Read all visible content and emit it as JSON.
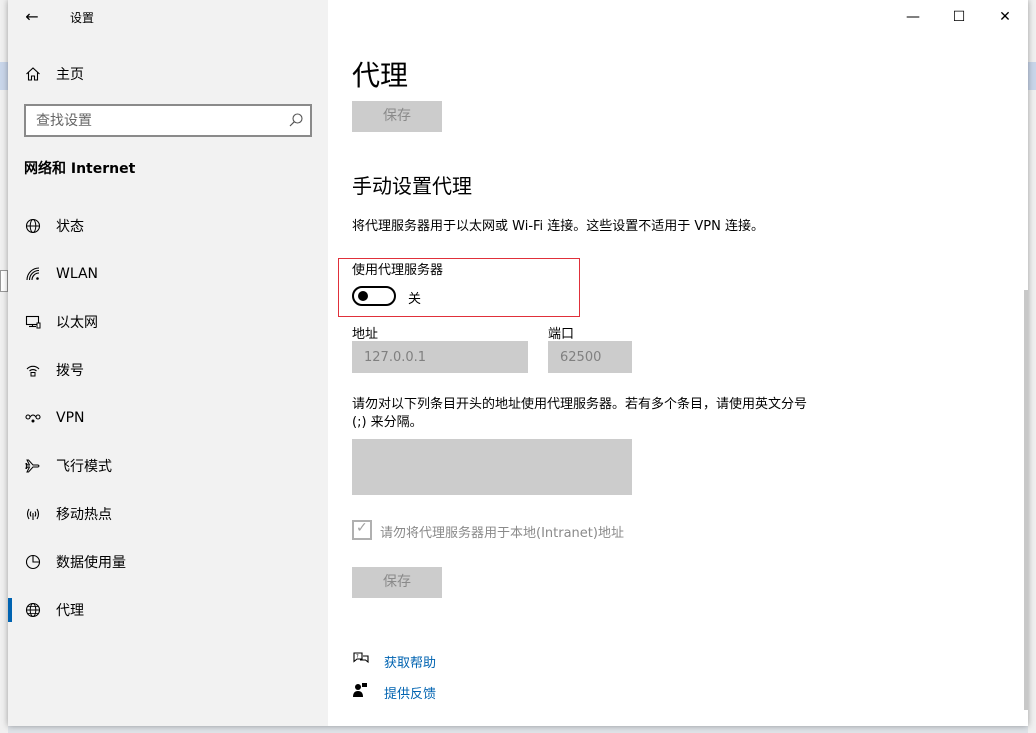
{
  "window": {
    "app_title": "设置"
  },
  "titlebar": {
    "back_glyph": "←",
    "minimize_glyph": "—",
    "maximize_glyph": "☐",
    "close_glyph": "✕"
  },
  "sidebar": {
    "home_label": "主页",
    "search_placeholder": "查找设置",
    "section_title": "网络和 Internet",
    "items": [
      {
        "label": "状态",
        "icon": "globe-status-icon"
      },
      {
        "label": "WLAN",
        "icon": "wifi-icon"
      },
      {
        "label": "以太网",
        "icon": "ethernet-icon"
      },
      {
        "label": "拨号",
        "icon": "dialup-icon"
      },
      {
        "label": "VPN",
        "icon": "vpn-icon"
      },
      {
        "label": "飞行模式",
        "icon": "airplane-icon"
      },
      {
        "label": "移动热点",
        "icon": "hotspot-icon"
      },
      {
        "label": "数据使用量",
        "icon": "data-usage-icon"
      },
      {
        "label": "代理",
        "icon": "globe-icon",
        "active": true
      }
    ]
  },
  "content": {
    "page_title": "代理",
    "save_label": "保存",
    "manual_heading": "手动设置代理",
    "manual_desc": "将代理服务器用于以太网或 Wi-Fi 连接。这些设置不适用于 VPN 连接。",
    "use_proxy_label": "使用代理服务器",
    "use_proxy_state": "关",
    "use_proxy_on": false,
    "address_label": "地址",
    "address_value": "127.0.0.1",
    "port_label": "端口",
    "port_value": "62500",
    "exception_text": "请勿对以下列条目开头的地址使用代理服务器。若有多个条目，请使用英文分号 (;) 来分隔。",
    "exception_value": "",
    "local_checkbox_label": "请勿将代理服务器用于本地(Intranet)地址",
    "local_checkbox_checked": true,
    "save2_label": "保存",
    "help_label": "获取帮助",
    "feedback_label": "提供反馈"
  },
  "colors": {
    "accent": "#0063b1",
    "highlight_box": "#e0303a",
    "disabled_bg": "#cccccc",
    "sidebar_bg": "#f2f2f2"
  }
}
